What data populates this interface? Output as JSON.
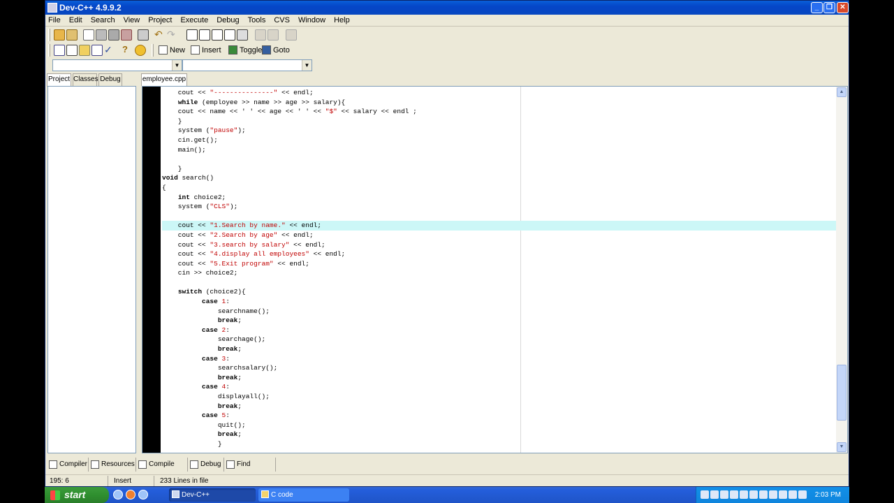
{
  "window": {
    "title": "Dev-C++ 4.9.9.2"
  },
  "menu": [
    "File",
    "Edit",
    "Search",
    "View",
    "Project",
    "Execute",
    "Debug",
    "Tools",
    "CVS",
    "Window",
    "Help"
  ],
  "toolbar2": {
    "new": "New",
    "insert": "Insert",
    "toggle": "Toggle",
    "goto": "Goto"
  },
  "left_tabs": [
    "Project",
    "Classes",
    "Debug"
  ],
  "file_tab": "employee.cpp",
  "code": [
    "    cout << \"---------------\" << endl;",
    "    while (employee >> name >> age >> salary){",
    "    cout << name << ' ' << age << ' ' << \"$\" << salary << endl ;",
    "    }",
    "    system (\"pause\");",
    "    cin.get();",
    "    main();",
    "",
    "    }",
    "void search()",
    "{",
    "    int choice2;",
    "    system (\"CLS\");",
    "",
    "    cout << \"1.Search by name.\" << endl;",
    "    cout << \"2.Search by age\" << endl;",
    "    cout << \"3.search by salary\" << endl;",
    "    cout << \"4.display all employees\" << endl;",
    "    cout << \"5.Exit program\" << endl;",
    "    cin >> choice2;",
    "",
    "    switch (choice2){",
    "          case 1:",
    "              searchname();",
    "              break;",
    "          case 2:",
    "              searchage();",
    "              break;",
    "          case 3:",
    "              searchsalary();",
    "              break;",
    "          case 4:",
    "              displayall();",
    "              break;",
    "          case 5:",
    "              quit();",
    "              break;",
    "              }"
  ],
  "highlight_line": 14,
  "bottom_tabs": [
    "Compiler",
    "Resources",
    "Compile Log",
    "Debug",
    "Find Results"
  ],
  "status": {
    "position": "195: 6",
    "mode": "Insert",
    "lines": "233 Lines in file"
  },
  "taskbar": {
    "start": "start",
    "tasks": [
      "Dev-C++",
      "C code"
    ],
    "clock": "2:03 PM"
  },
  "colors": {
    "string": "#c00000",
    "highlight": "#ccf7f7",
    "titlebar": "#0a5fd8"
  }
}
